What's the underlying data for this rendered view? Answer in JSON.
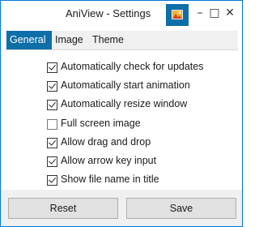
{
  "window": {
    "title": "AniView - Settings",
    "controls": {
      "minimize": "–",
      "maximize": "□",
      "close": "✕"
    }
  },
  "tabs": [
    {
      "label": "General",
      "active": true
    },
    {
      "label": "Image",
      "active": false
    },
    {
      "label": "Theme",
      "active": false
    }
  ],
  "options": [
    {
      "label": "Automatically check for updates",
      "checked": true
    },
    {
      "label": "Automatically start animation",
      "checked": true
    },
    {
      "label": "Automatically resize window",
      "checked": true
    },
    {
      "label": "Full screen image",
      "checked": false
    },
    {
      "label": "Allow drag and drop",
      "checked": true
    },
    {
      "label": "Allow arrow key input",
      "checked": true
    },
    {
      "label": "Show file name in title",
      "checked": true
    }
  ],
  "footer": {
    "reset_label": "Reset",
    "save_label": "Save"
  },
  "colors": {
    "accent": "#0e6fa8",
    "window_border": "#0078d7",
    "footer_bg": "#f0f0f0"
  },
  "icons": {
    "title_button": "image-icon"
  }
}
